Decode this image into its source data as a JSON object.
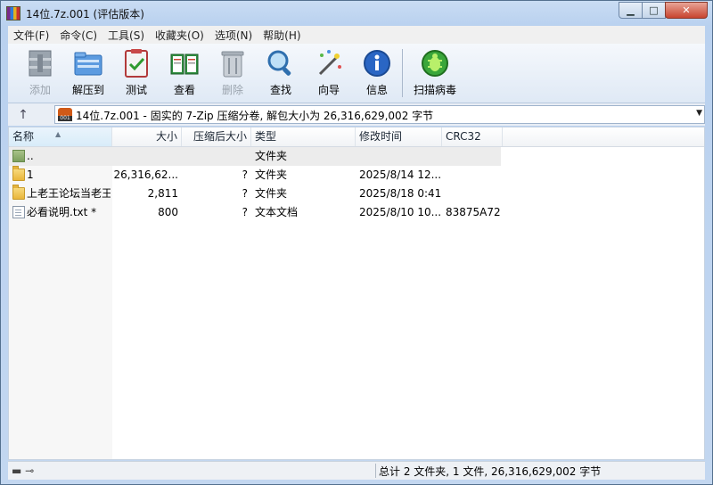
{
  "window": {
    "title": "14位.7z.001 (评估版本)"
  },
  "menu": [
    "文件(F)",
    "命令(C)",
    "工具(S)",
    "收藏夹(O)",
    "选项(N)",
    "帮助(H)"
  ],
  "toolbar": {
    "add": "添加",
    "extract": "解压到",
    "test": "测试",
    "view": "查看",
    "delete": "删除",
    "find": "查找",
    "wizard": "向导",
    "info": "信息",
    "scan": "扫描病毒"
  },
  "address": {
    "text": "14位.7z.001 - 固实的 7-Zip 压缩分卷, 解包大小为 26,316,629,002 字节"
  },
  "columns": {
    "name": "名称",
    "size": "大小",
    "packed": "压缩后大小",
    "type": "类型",
    "modified": "修改时间",
    "crc": "CRC32"
  },
  "rows": [
    {
      "name": "..",
      "size": "",
      "packed": "",
      "type": "文件夹",
      "modified": "",
      "crc": ""
    },
    {
      "name": "1",
      "size": "26,316,62...",
      "packed": "?",
      "type": "文件夹",
      "modified": "2025/8/14 12...",
      "crc": ""
    },
    {
      "name": "上老王论坛当老王",
      "size": "2,811",
      "packed": "?",
      "type": "文件夹",
      "modified": "2025/8/18 0:41",
      "crc": ""
    },
    {
      "name": "必看说明.txt *",
      "size": "800",
      "packed": "?",
      "type": "文本文档",
      "modified": "2025/8/10 10...",
      "crc": "83875A72"
    }
  ],
  "status": {
    "summary": "总计 2 文件夹, 1 文件, 26,316,629,002 字节"
  },
  "colors": {
    "title_bg": "#c9dcf3",
    "close": "#c8442f"
  }
}
